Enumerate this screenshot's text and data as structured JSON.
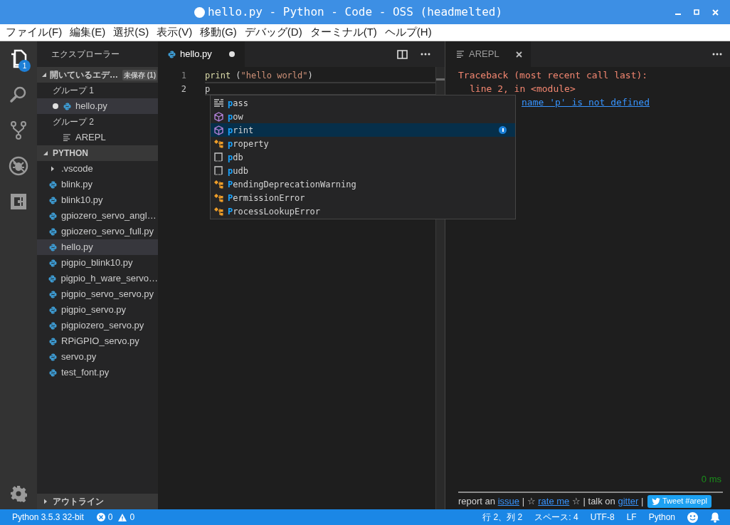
{
  "window": {
    "title": "hello.py - Python - Code - OSS (headmelted)",
    "unsaved": true
  },
  "menu": [
    "ファイル(F)",
    "編集(E)",
    "選択(S)",
    "表示(V)",
    "移動(G)",
    "デバッグ(D)",
    "ターミナル(T)",
    "ヘルプ(H)"
  ],
  "activity_bar": [
    {
      "kind": "explorer",
      "selected": true,
      "badge": "1"
    },
    {
      "kind": "search",
      "selected": false
    },
    {
      "kind": "source-control",
      "selected": false
    },
    {
      "kind": "debug",
      "selected": false
    },
    {
      "kind": "extensions",
      "selected": false
    },
    {
      "kind": "settings",
      "selected": false
    }
  ],
  "sidebar": {
    "title": "エクスプローラー",
    "open_editors": {
      "title": "開いているエデ…",
      "badge": "未保存 (1)",
      "expanded": true,
      "groups": [
        {
          "label": "グループ 1",
          "files": [
            {
              "name": "hello.py",
              "kind": "python",
              "dirty": true,
              "selected": true
            }
          ]
        },
        {
          "label": "グループ 2",
          "files": [
            {
              "name": "AREPL",
              "kind": "preview",
              "dirty": false,
              "selected": false
            }
          ]
        }
      ]
    },
    "folder": {
      "title": "PYTHON",
      "expanded": true,
      "children": [
        {
          "name": ".vscode",
          "kind": "folder",
          "expanded": false,
          "selected": false
        },
        {
          "name": "blink.py",
          "kind": "python",
          "selected": false
        },
        {
          "name": "blink10.py",
          "kind": "python",
          "selected": false
        },
        {
          "name": "gpiozero_servo_angl…",
          "kind": "python",
          "selected": false
        },
        {
          "name": "gpiozero_servo_full.py",
          "kind": "python",
          "selected": false
        },
        {
          "name": "hello.py",
          "kind": "python",
          "selected": true
        },
        {
          "name": "pigpio_blink10.py",
          "kind": "python",
          "selected": false
        },
        {
          "name": "pigpio_h_ware_servo…",
          "kind": "python",
          "selected": false
        },
        {
          "name": "pigpio_servo_servo.py",
          "kind": "python",
          "selected": false
        },
        {
          "name": "pigpio_servo.py",
          "kind": "python",
          "selected": false
        },
        {
          "name": "pigpiozero_servo.py",
          "kind": "python",
          "selected": false
        },
        {
          "name": "RPiGPIO_servo.py",
          "kind": "python",
          "selected": false
        },
        {
          "name": "servo.py",
          "kind": "python",
          "selected": false
        },
        {
          "name": "test_font.py",
          "kind": "python",
          "selected": false
        }
      ]
    },
    "outline": {
      "title": "アウトライン",
      "expanded": false
    }
  },
  "editor": {
    "tab": {
      "name": "hello.py",
      "dirty": true
    },
    "lines": [
      {
        "number": "1",
        "current": false,
        "tokens": [
          {
            "kind": "function",
            "text": "print"
          },
          {
            "kind": "plain",
            "text": " ("
          },
          {
            "kind": "string",
            "text": "\"hello world\""
          },
          {
            "kind": "plain",
            "text": ")"
          }
        ]
      },
      {
        "number": "2",
        "current": true,
        "tokens": [
          {
            "kind": "plain",
            "text": "p"
          }
        ]
      }
    ],
    "suggestions": [
      {
        "match": "p",
        "rest": "ass",
        "kind": "keyword",
        "selected": false
      },
      {
        "match": "p",
        "rest": "ow",
        "kind": "function",
        "selected": false
      },
      {
        "match": "p",
        "rest": "rint",
        "kind": "function",
        "selected": true
      },
      {
        "match": "p",
        "rest": "roperty",
        "kind": "class",
        "selected": false
      },
      {
        "match": "p",
        "rest": "db",
        "kind": "module",
        "selected": false
      },
      {
        "match": "p",
        "rest": "udb",
        "kind": "module",
        "selected": false
      },
      {
        "match": "P",
        "rest": "endingDeprecationWarning",
        "kind": "class",
        "selected": false
      },
      {
        "match": "P",
        "rest": "ermissionError",
        "kind": "class",
        "selected": false
      },
      {
        "match": "P",
        "rest": "rocessLookupError",
        "kind": "class",
        "selected": false
      }
    ]
  },
  "arepl": {
    "tab": "AREPL",
    "output": [
      {
        "kind": "error",
        "text": "Traceback (most recent call last):"
      },
      {
        "kind": "error-indent",
        "text": "line 2, in <module>"
      },
      {
        "kind": "link",
        "text": "name 'p' is not defined"
      }
    ],
    "timing": "0 ms",
    "footer": [
      {
        "kind": "text",
        "text": "report an "
      },
      {
        "kind": "link",
        "text": "issue"
      },
      {
        "kind": "text",
        "text": " | ☆ "
      },
      {
        "kind": "link",
        "text": "rate me"
      },
      {
        "kind": "text",
        "text": " ☆ | talk on "
      },
      {
        "kind": "link",
        "text": "gitter"
      },
      {
        "kind": "text",
        "text": " | "
      }
    ],
    "tweet_button": "Tweet #arepl"
  },
  "status_bar": {
    "interpreter": "Python 3.5.3 32-bit",
    "errors": "0",
    "warnings": "0",
    "right": [
      "行 2、列 2",
      "スペース: 4",
      "UTF-8",
      "LF",
      "Python"
    ]
  }
}
